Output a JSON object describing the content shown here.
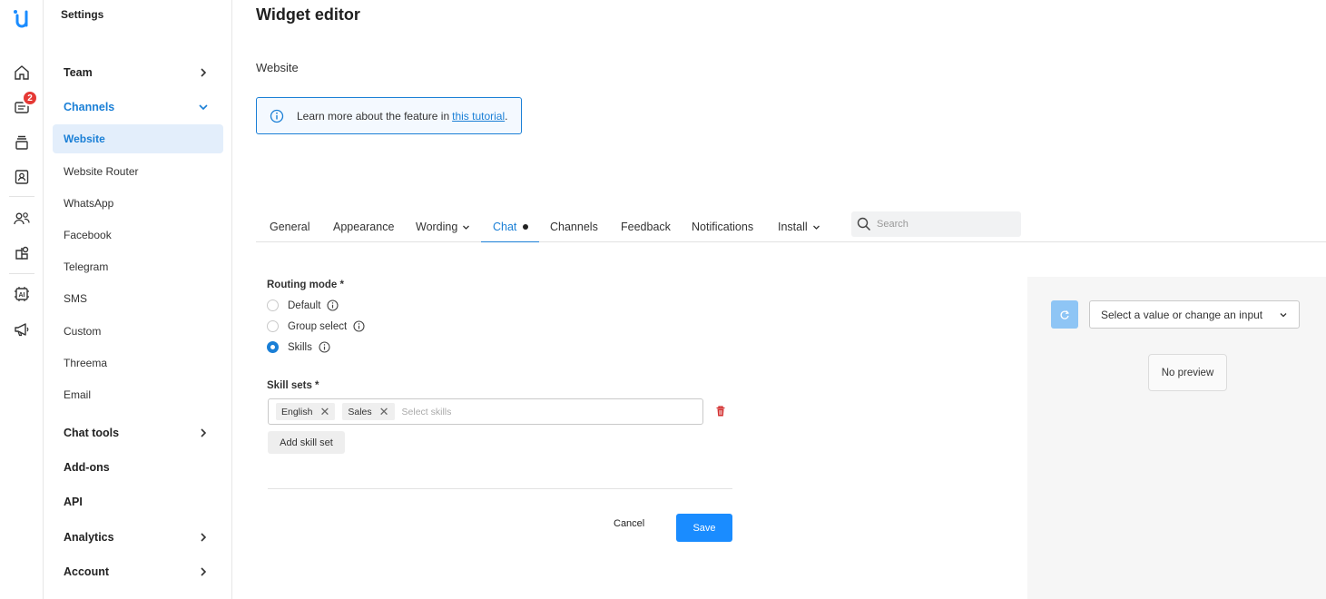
{
  "app": {
    "logo": "U-logo"
  },
  "rail": {
    "icons": [
      "home-icon",
      "chat-icon",
      "inbox-icon",
      "contacts-icon",
      "team-icon",
      "apps-icon",
      "ai-icon",
      "megaphone-icon"
    ],
    "chat_badge": "2"
  },
  "sidebar": {
    "title": "Settings",
    "items": [
      {
        "label": "Team",
        "expandable": true
      },
      {
        "label": "Channels",
        "expanded": true
      },
      {
        "label": "Website",
        "active": true
      },
      {
        "label": "Website Router"
      },
      {
        "label": "WhatsApp"
      },
      {
        "label": "Facebook"
      },
      {
        "label": "Telegram"
      },
      {
        "label": "SMS"
      },
      {
        "label": "Custom"
      },
      {
        "label": "Threema"
      },
      {
        "label": "Email"
      },
      {
        "label": "Chat tools",
        "expandable": true
      },
      {
        "label": "Add-ons"
      },
      {
        "label": "API"
      },
      {
        "label": "Analytics",
        "expandable": true
      },
      {
        "label": "Account",
        "expandable": true
      }
    ]
  },
  "main": {
    "title": "Widget editor",
    "subtitle": "Website",
    "info": {
      "text": "Learn more about the feature in",
      "link": "this tutorial",
      "suffix": "."
    },
    "tabs": [
      {
        "label": "General"
      },
      {
        "label": "Appearance"
      },
      {
        "label": "Wording"
      },
      {
        "label": "Chat",
        "active": true
      },
      {
        "label": "Channels"
      },
      {
        "label": "Feedback"
      },
      {
        "label": "Notifications"
      },
      {
        "label": "Install"
      }
    ],
    "search": {
      "placeholder": "Search"
    },
    "routing": {
      "label": "Routing mode *",
      "options": [
        {
          "label": "Default",
          "selected": false
        },
        {
          "label": "Group select",
          "selected": false
        },
        {
          "label": "Skills",
          "selected": true
        }
      ]
    },
    "skill_sets": {
      "label": "Skill sets *",
      "chips": [
        "English",
        "Sales"
      ],
      "placeholder": "Select skills",
      "add_label": "Add skill set"
    },
    "actions": {
      "cancel": "Cancel",
      "save": "Save"
    }
  },
  "preview": {
    "select_value": "Select a value or change an input",
    "empty_text": "No preview"
  },
  "colors": {
    "accent": "#1a8cff",
    "badge": "#e53935",
    "active_bg": "#e3eefb"
  }
}
